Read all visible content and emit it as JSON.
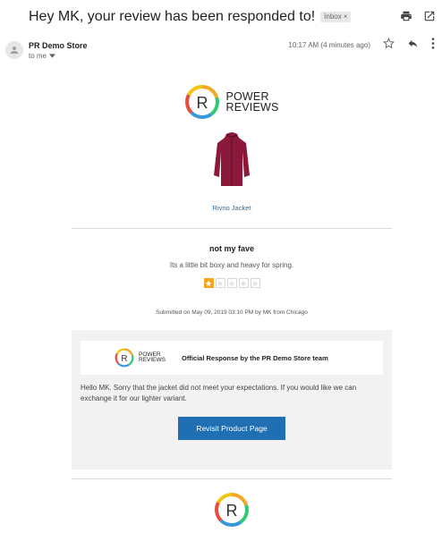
{
  "email": {
    "subject": "Hey MK, your review has been responded to!",
    "label_chip": "Inbox",
    "label_chip_close": "×",
    "sender_name": "PR Demo Store",
    "recipient": "to me",
    "timestamp": "10:17 AM (4 minutes ago)"
  },
  "brand": {
    "logo_letter": "R",
    "logo_line1": "POWER",
    "logo_line2": "REVIEWS",
    "ring_colors": [
      "#e84c3d",
      "#f5a623",
      "#f1c40f",
      "#2ecc71",
      "#3498db"
    ]
  },
  "product": {
    "name": "Rivno Jacket",
    "jacket_color": "#8b1a3a"
  },
  "review": {
    "title": "not my fave",
    "body": "Its a little bit boxy and heavy for spring.",
    "rating": 1,
    "max_rating": 5,
    "submitted": "Submitted on May 09, 2019 03:10 PM by MK from Chicago"
  },
  "response": {
    "title": "Official Response by the PR Demo Store team",
    "message": "Hello MK. Sorry that the jacket did not meet your expectations. If you would like we can exchange it for our lighter variant.",
    "button_label": "Revisit Product Page"
  },
  "colors": {
    "accent": "#1f6fb2",
    "star": "#f5a623"
  }
}
